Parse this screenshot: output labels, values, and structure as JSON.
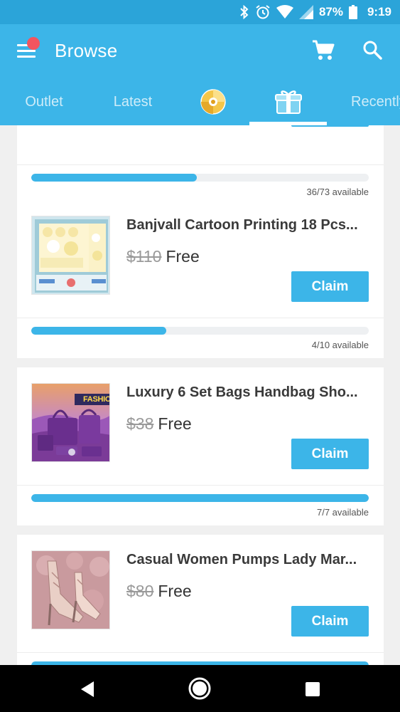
{
  "status_bar": {
    "battery_percent": "87%",
    "time": "9:19",
    "icons": [
      "bluetooth-icon",
      "alarm-icon",
      "wifi-icon",
      "signal-icon",
      "battery-icon"
    ]
  },
  "app_bar": {
    "title": "Browse",
    "icons": [
      "menu-icon",
      "notification-dot",
      "cart-icon",
      "search-icon"
    ],
    "accent_color": "#3cb5e8",
    "dot_color": "#f2555f"
  },
  "tabs": [
    {
      "label": "Outlet",
      "selected": false
    },
    {
      "label": "Latest",
      "selected": false
    },
    {
      "label": "",
      "icon": "disc-icon",
      "selected": false
    },
    {
      "label": "",
      "icon": "gift-icon",
      "selected": true
    },
    {
      "label": "Recently",
      "selected": false
    }
  ],
  "partial_card": {
    "claimed": 36,
    "total": 73,
    "available_text": "36/73 available",
    "progress": 0.49
  },
  "products": [
    {
      "name": "Banjvall Cartoon Printing 18 Pcs...",
      "old_price": "$110",
      "price": "Free",
      "claim_label": "Claim",
      "available_text": "4/10 available",
      "progress": 0.4,
      "image": "baby-clothes-gift-set-image"
    },
    {
      "name": "Luxury 6 Set Bags Handbag Sho...",
      "old_price": "$38",
      "price": "Free",
      "claim_label": "Claim",
      "available_text": "7/7 available",
      "progress": 1.0,
      "image": "purple-handbag-set-image",
      "image_text": "FASHION"
    },
    {
      "name": "Casual Women Pumps Lady Mar...",
      "old_price": "$80",
      "price": "Free",
      "claim_label": "Claim",
      "image": "pink-heeled-pumps-image"
    }
  ],
  "nav_bar": {
    "icons": [
      "back-icon",
      "home-icon",
      "recents-icon"
    ]
  }
}
